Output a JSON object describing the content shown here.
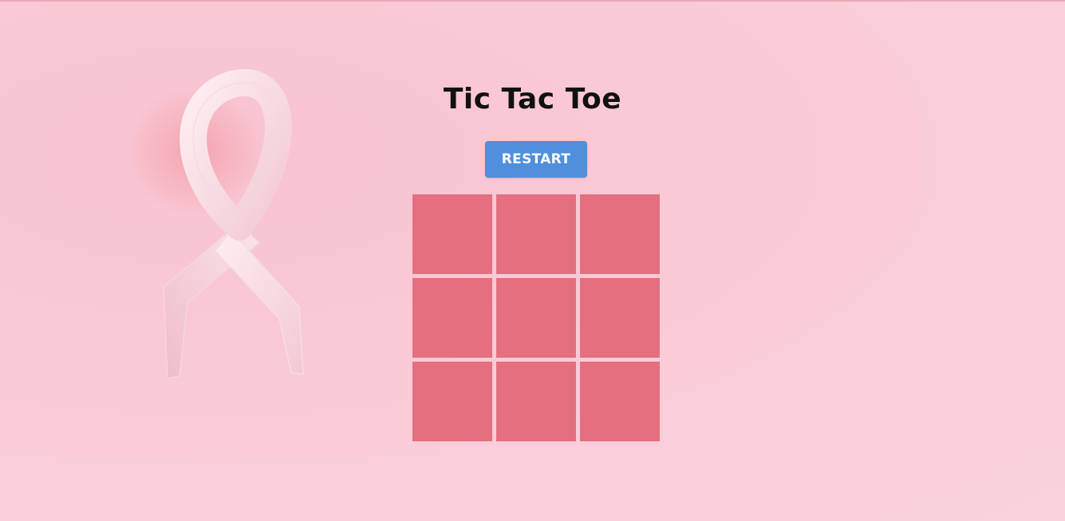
{
  "page": {
    "title": "Tic Tac Toe"
  },
  "controls": {
    "restart_label": "RESTART"
  },
  "board": {
    "cells": [
      "",
      "",
      "",
      "",
      "",
      "",
      "",
      "",
      ""
    ]
  },
  "colors": {
    "background": "#f9cad6",
    "button": "#4f8fdc",
    "cell": "#e36f7f",
    "title": "#111111"
  },
  "decoration": {
    "image": "pink-ribbon"
  }
}
